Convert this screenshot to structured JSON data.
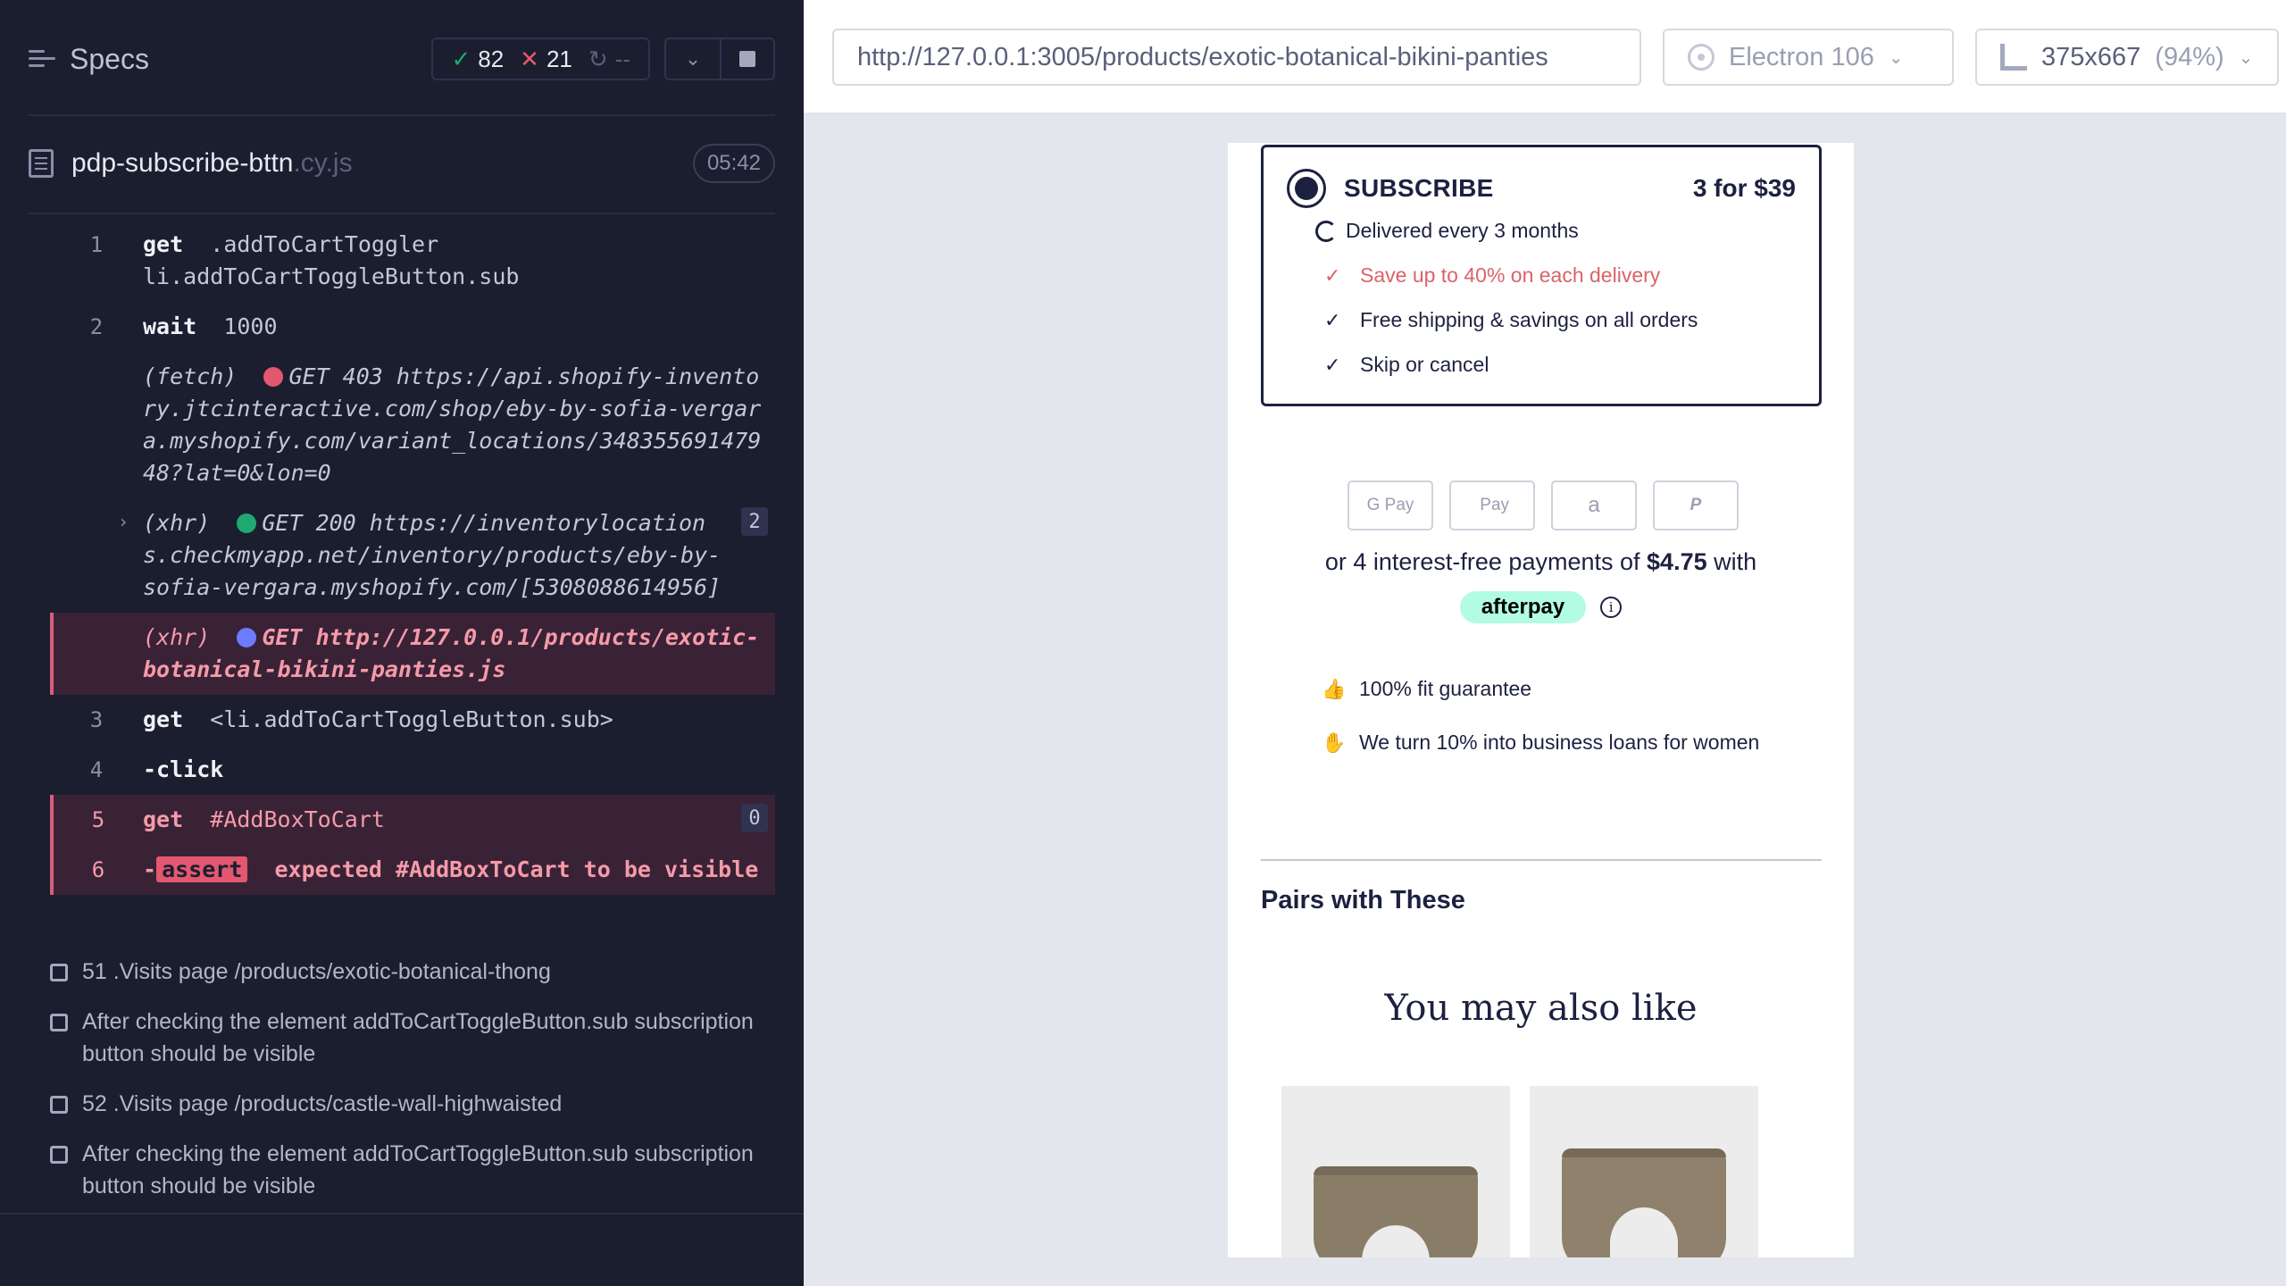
{
  "reporter": {
    "title": "Specs",
    "stats": {
      "passed": "82",
      "failed": "21",
      "pending": "--"
    },
    "file": {
      "name": "pdp-subscribe-bttn",
      "ext": ".cy.js",
      "duration": "05:42"
    },
    "commands": [
      {
        "num": "1",
        "keyword": "get",
        "arg": ".addToCartToggler li.addToCartToggleButton.sub"
      },
      {
        "num": "2",
        "keyword": "wait",
        "arg": "1000"
      },
      {
        "num": "",
        "keyword": "(fetch)",
        "arg": "GET 403 https://api.shopify-inventory.jtcinteractive.com/shop/eby-by-sofia-vergara.myshopify.com/variant_locations/34835569147948?lat=0&lon=0"
      },
      {
        "num": "",
        "keyword": "(xhr)",
        "arg": "GET 200 https://inventorylocations.checkmyapp.net/inventory/products/eby-by-sofia-vergara.myshopify.com/[5308088614956]",
        "badge": "2"
      },
      {
        "num": "",
        "keyword": "(xhr)",
        "arg": "GET http://127.0.0.1/products/exotic-botanical-bikini-panties.js"
      },
      {
        "num": "3",
        "keyword": "get",
        "arg": "<li.addToCartToggleButton.sub>"
      },
      {
        "num": "4",
        "keyword": "-click",
        "arg": ""
      },
      {
        "num": "5",
        "keyword": "get",
        "arg": "#AddBoxToCart",
        "badge": "0"
      },
      {
        "num": "6",
        "keyword": "-",
        "assert": "assert",
        "arg": "expected #AddBoxToCart to be visible"
      }
    ],
    "tests": [
      "51 .Visits page /products/exotic-botanical-thong",
      "After checking the element addToCartToggleButton.sub subscription button should be visible",
      "52 .Visits page /products/castle-wall-highwaisted",
      "After checking the element addToCartToggleButton.sub subscription button should be visible"
    ]
  },
  "aut": {
    "url": "http://127.0.0.1:3005/products/exotic-botanical-bikini-panties",
    "browser": "Electron 106",
    "viewport": "375x667",
    "scale": "(94%)"
  },
  "page": {
    "subscribe": {
      "title": "SUBSCRIBE",
      "price": "3 for $39",
      "delivery": "Delivered every 3 months",
      "perks": [
        "Save up to 40% on each delivery",
        "Free shipping & savings on all orders",
        "Skip or cancel"
      ]
    },
    "payments": [
      "G Pay",
      "Pay",
      "a",
      "P"
    ],
    "installments": {
      "prefix": "or 4 interest-free payments of",
      "amount": "$4.75",
      "suffix": "with"
    },
    "afterpay": "afterpay",
    "guarantees": [
      "100% fit guarantee",
      "We turn 10% into business loans for women"
    ],
    "pairs_heading": "Pairs with These",
    "also_like": "You may also like"
  },
  "colors": {
    "reporter_bg": "#1b1e2e",
    "fail": "#e45770",
    "pass": "#1fa971",
    "afterpay": "#b2fce4",
    "navy": "#1d2140"
  }
}
